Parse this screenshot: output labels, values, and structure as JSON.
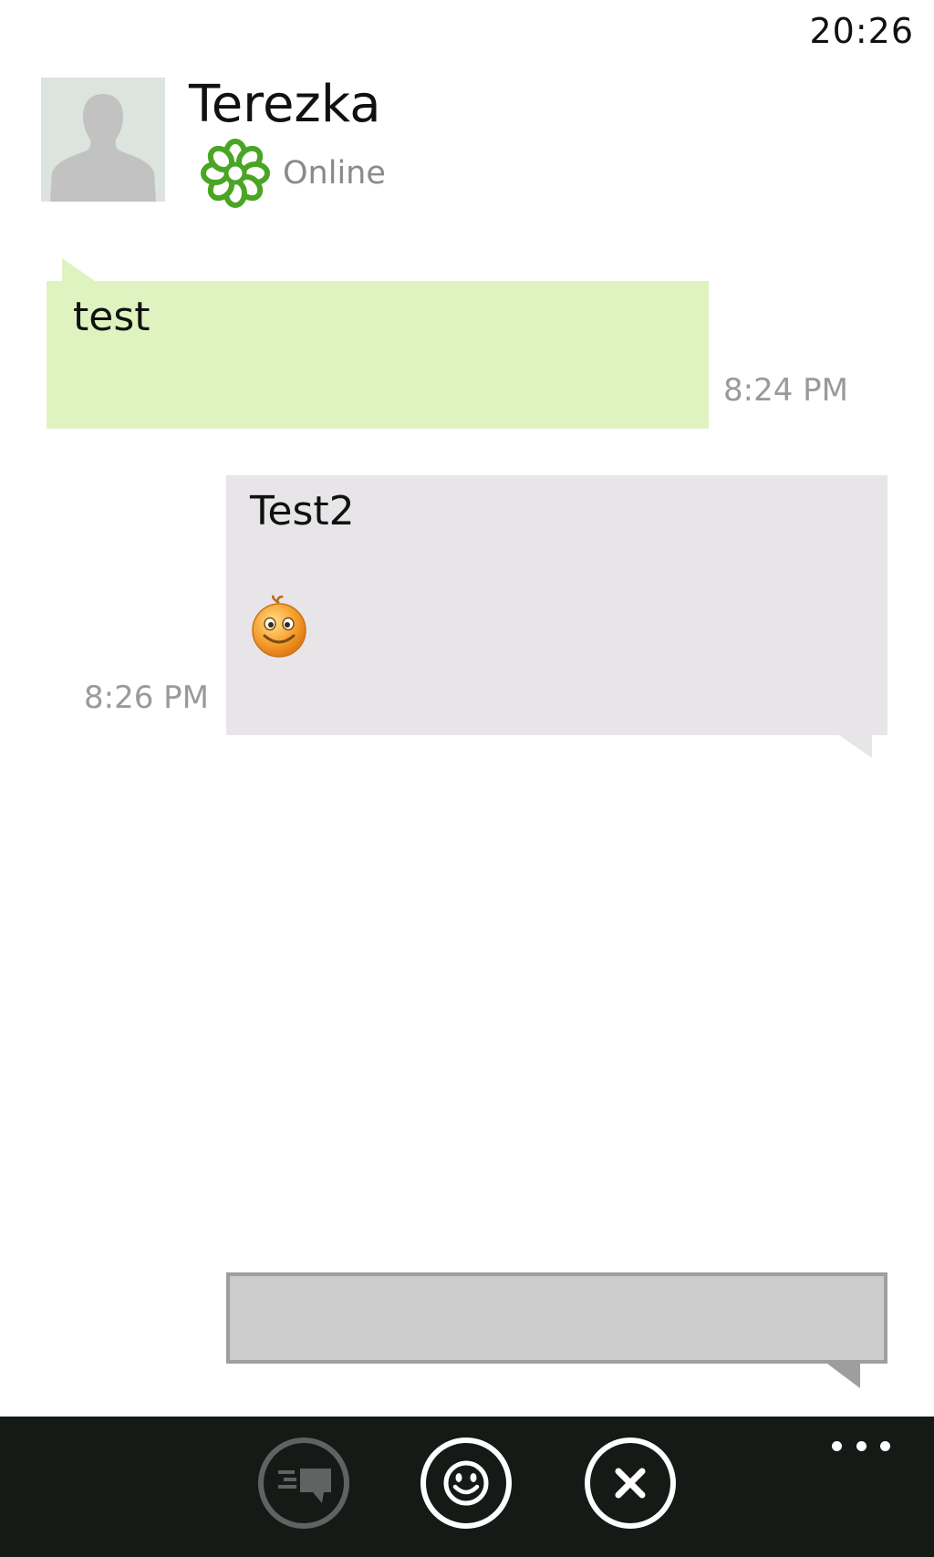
{
  "status_bar": {
    "clock": "20:26"
  },
  "contact": {
    "name": "Terezka",
    "presence": "Online",
    "presence_icon": "icq-flower-icon",
    "avatar_icon": "person-silhouette-icon"
  },
  "messages": [
    {
      "direction": "incoming",
      "text": "test",
      "time": "8:24 PM"
    },
    {
      "direction": "outgoing",
      "text": "Test2",
      "emoticon": "smiley-face-icon",
      "time": "8:26 PM"
    }
  ],
  "compose": {
    "value": "",
    "placeholder": ""
  },
  "app_bar": {
    "buttons": [
      {
        "icon": "message-history-icon",
        "enabled": false
      },
      {
        "icon": "smiley-icon",
        "enabled": true
      },
      {
        "icon": "close-icon",
        "enabled": true
      }
    ],
    "more_icon": "more-ellipsis-icon"
  },
  "colors": {
    "incoming_bubble": "#dff3c1",
    "outgoing_bubble": "#e7e5e8",
    "compose_bg": "#cccccc",
    "app_bar_bg": "#161a17",
    "presence_green": "#4aa524"
  }
}
